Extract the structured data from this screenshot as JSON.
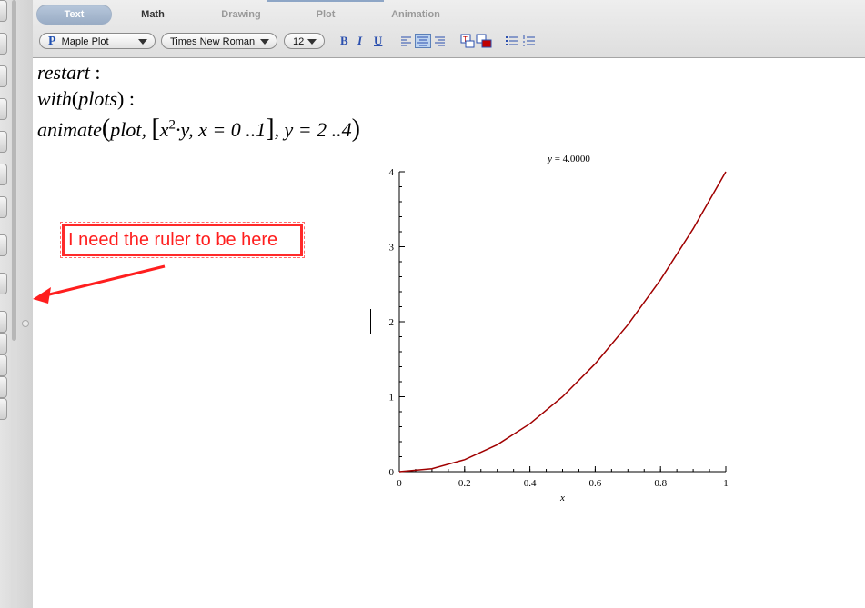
{
  "toolbar": {
    "tabs": [
      "Text",
      "Math",
      "Drawing",
      "Plot",
      "Animation"
    ],
    "active_tab": "Text",
    "style_dropdown": "Maple Plot",
    "style_dropdown_icon": "P",
    "font_dropdown": "Times New Roman",
    "size_dropdown": "12",
    "bold_label": "B",
    "italic_label": "I",
    "underline_label": "U",
    "icons": [
      "align-left-icon",
      "align-center-icon",
      "align-right-icon",
      "text-color-icon",
      "highlight-color-icon",
      "bullet-list-icon",
      "numbered-list-icon"
    ]
  },
  "document": {
    "lines": [
      {
        "fn": "restart",
        "tail": " :"
      },
      {
        "fn": "with",
        "arg": "plots",
        "tail": " :"
      },
      {
        "fn": "animate",
        "text": "plot, [x²·y, x = 0 ..1], y = 2 ..4"
      }
    ],
    "line1_fn": "restart",
    "line1_tail": ":",
    "line2_fn": "with",
    "line2_arg": "plots",
    "line2_tail": ":",
    "line3_fn": "animate",
    "line3_plot": "plot,",
    "line3_base": "x",
    "line3_exp": "2",
    "line3_rest1": "·y, x = 0 ..1",
    "line3_rest2": ", y = 2 ..4"
  },
  "annotation": {
    "text": "I need the ruler to be here",
    "color": "#ff1e1e"
  },
  "chart_data": {
    "type": "line",
    "title_var": "y",
    "title_value": "4.0000",
    "title": "y = 4.0000",
    "xlabel": "x",
    "ylabel": "",
    "xlim": [
      0,
      1
    ],
    "ylim": [
      0,
      4
    ],
    "xticks": [
      "0",
      "0.2",
      "0.4",
      "0.6",
      "0.8",
      "1"
    ],
    "yticks": [
      "0",
      "1",
      "2",
      "3",
      "4"
    ],
    "series": [
      {
        "color": "#a00000",
        "x": [
          0,
          0.1,
          0.2,
          0.3,
          0.4,
          0.5,
          0.6,
          0.7,
          0.8,
          0.9,
          1.0
        ],
        "y": [
          0,
          0.04,
          0.16,
          0.36,
          0.64,
          1.0,
          1.44,
          1.96,
          2.56,
          3.24,
          4.0
        ]
      }
    ],
    "grid": false
  }
}
